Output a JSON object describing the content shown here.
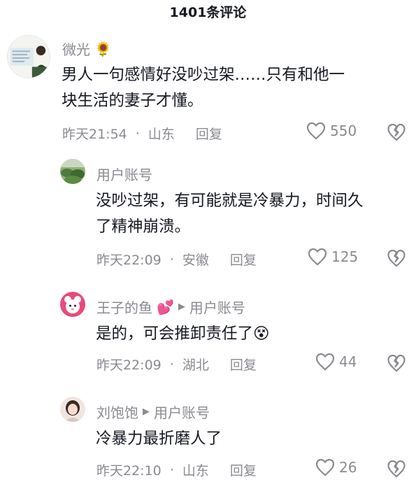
{
  "header": {
    "title": "1401条评论"
  },
  "comments": [
    {
      "username": "微光",
      "emoji": "🌻",
      "text_lines": [
        "男人一句感情好没吵过架……只有和他一",
        "块生活的妻子才懂。"
      ],
      "time": "昨天21:54",
      "location": "山东",
      "reply_label": "回复",
      "likes": "550"
    },
    {
      "username": "用户账号",
      "text_lines": [
        "没吵过架，有可能就是冷暴力，时间久",
        "了精神崩溃。"
      ],
      "time": "昨天22:09",
      "location": "安徽",
      "reply_label": "回复",
      "likes": "125"
    },
    {
      "username": "王子的鱼",
      "emoji": "💕",
      "reply_to": "用户账号",
      "text_lines": [
        "是的，可会推卸责任了😵"
      ],
      "time": "昨天22:09",
      "location": "湖北",
      "reply_label": "回复",
      "likes": "44"
    },
    {
      "username": "刘饱饱",
      "reply_to": "用户账号",
      "text_lines": [
        "冷暴力最折磨人了"
      ],
      "time": "昨天22:10",
      "location": "山东",
      "reply_label": "回复",
      "likes": "26"
    }
  ],
  "icons": {
    "like": "heart-outline-icon",
    "dislike": "broken-heart-icon",
    "reply_arrow": "triangle-right-icon"
  },
  "colors": {
    "text": "#161823",
    "muted": "#8a8b91",
    "background": "#ffffff"
  }
}
